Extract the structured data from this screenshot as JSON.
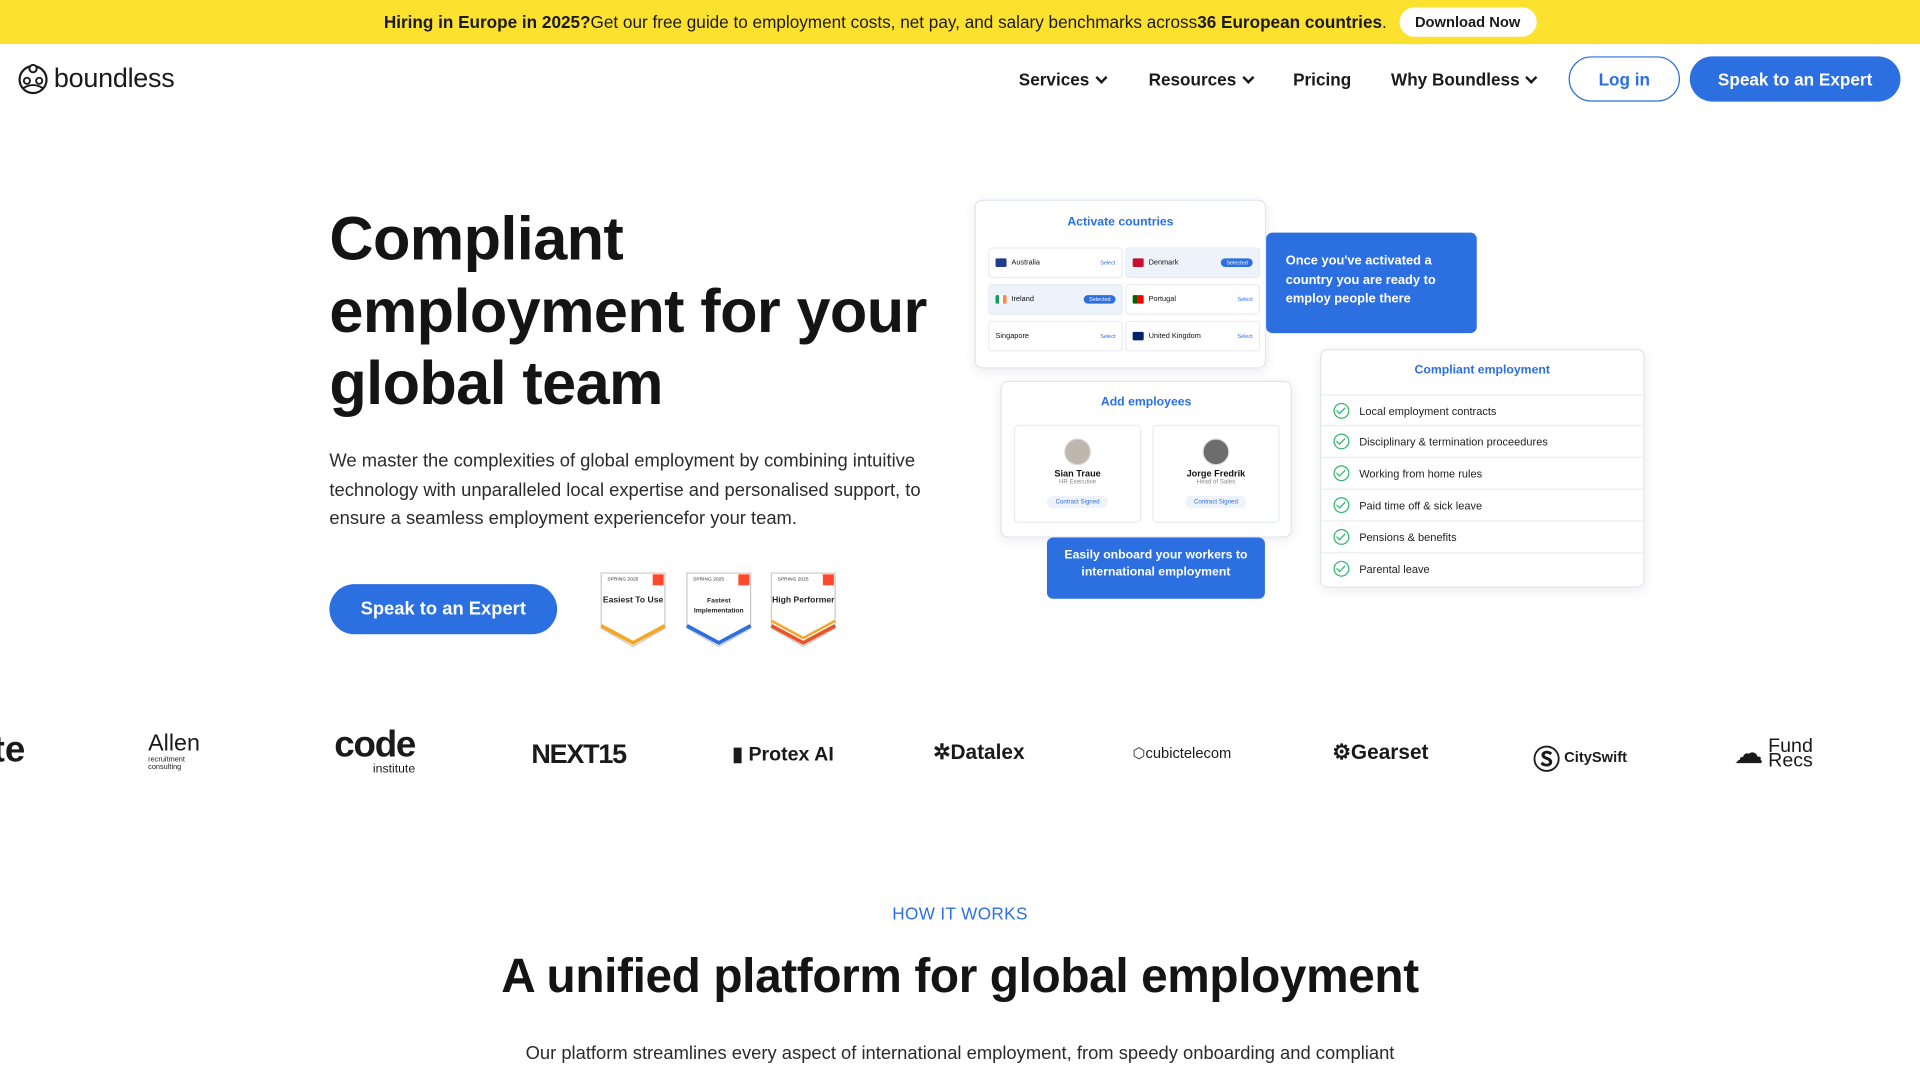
{
  "banner": {
    "lead": "Hiring in Europe in 2025?",
    "text": " Get our free guide to employment costs, net pay, and salary benchmarks across ",
    "highlight": "36 European countries",
    "end": ".",
    "button": "Download Now",
    "color": "#fce12e"
  },
  "nav": {
    "logo": "boundless",
    "items": [
      {
        "label": "Services",
        "dropdown": true
      },
      {
        "label": "Resources",
        "dropdown": true
      },
      {
        "label": "Pricing",
        "dropdown": false
      },
      {
        "label": "Why Boundless",
        "dropdown": true
      }
    ],
    "login": "Log in",
    "cta": "Speak to an Expert"
  },
  "hero": {
    "title": "Compliant employment for your global team",
    "description": "We master the complexities of global employment by combining intuitive technology with unparalleled local expertise and personalised support, to ensure a seamless employment experiencefor your team.",
    "cta": "Speak to an Expert",
    "badges": [
      {
        "season": "SPRING 2025",
        "label": "Easiest To Use",
        "color": "#f5a623"
      },
      {
        "season": "SPRING 2025",
        "label": "Fastest Implementation",
        "color": "#2b6fe0"
      },
      {
        "season": "SPRING 2025",
        "label": "High Performer",
        "color": "#e8552b"
      }
    ]
  },
  "illustration": {
    "activate": {
      "title": "Activate countries",
      "countries": [
        {
          "name": "Australia",
          "status": "Select",
          "selected": false
        },
        {
          "name": "Denmark",
          "status": "Selected",
          "selected": true
        },
        {
          "name": "Ireland",
          "status": "Selected",
          "selected": true
        },
        {
          "name": "Portugal",
          "status": "Select",
          "selected": false
        },
        {
          "name": "Singapore",
          "status": "Select",
          "selected": false
        },
        {
          "name": "United Kingdom",
          "status": "Select",
          "selected": false
        }
      ]
    },
    "activated_note": "Once you've activated a country you are ready to employ people there",
    "employees": {
      "title": "Add employees",
      "people": [
        {
          "name": "Sian Traue",
          "role": "HR Executive",
          "status": "Contract Signed"
        },
        {
          "name": "Jorge Fredrik",
          "role": "Head of Sales",
          "status": "Contract Signed"
        }
      ]
    },
    "onboard_note": "Easily onboard your workers to international employment",
    "compliant": {
      "title": "Compliant employment",
      "items": [
        "Local employment contracts",
        "Disciplinary & termination proceedures",
        "Working from home rules",
        "Paid time off & sick leave",
        "Pensions & benefits",
        "Parental leave"
      ]
    }
  },
  "clients": [
    "te",
    "Allen",
    "code",
    "NEXT15",
    "Protex AI",
    "Datalex",
    "cubictelecom",
    "Gearset",
    "CitySwift",
    "Fund Recs"
  ],
  "client_subs": {
    "allen": "recruitment consulting",
    "code": "institute"
  },
  "how": {
    "label": "HOW IT WORKS",
    "title": "A unified platform for global employment",
    "description": "Our platform streamlines every aspect of international employment, from speedy onboarding and compliant"
  }
}
